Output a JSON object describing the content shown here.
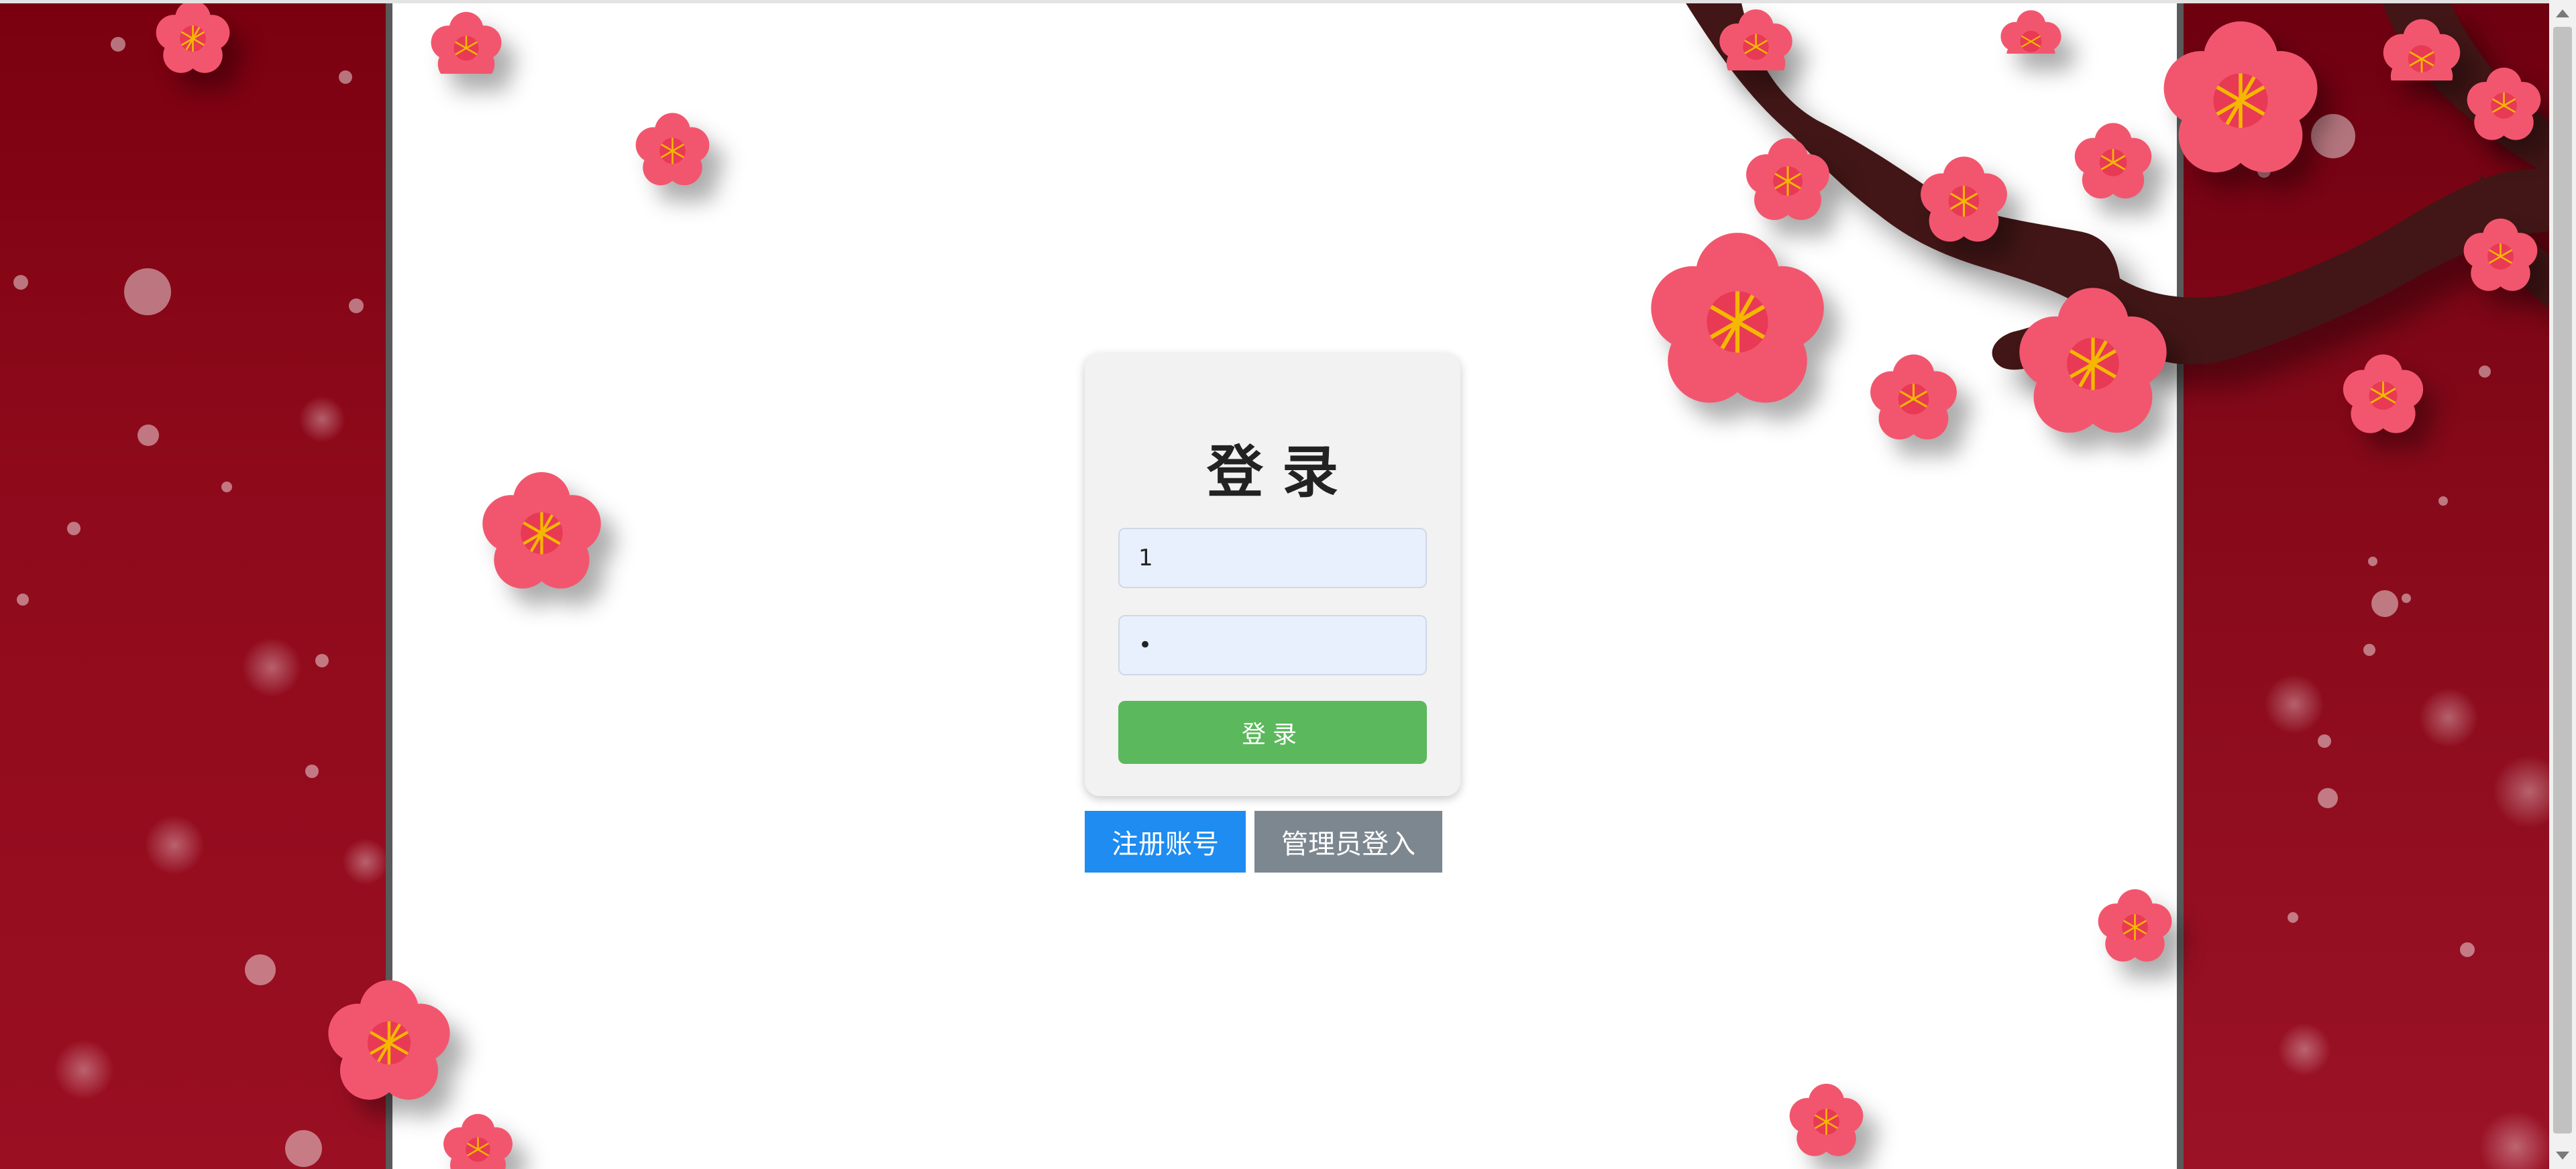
{
  "login": {
    "title": "登录",
    "username_value": "1",
    "password_value": "1",
    "submit_label": "登录"
  },
  "actions": {
    "register_label": "注册账号",
    "admin_login_label": "管理员登入"
  },
  "colors": {
    "panel_red": "#8e0a1b",
    "login_green": "#5cb85c",
    "register_blue": "#1e8cf0",
    "admin_gray": "#7d8790",
    "blossom_pink": "#f2566e",
    "branch_brown": "#421413"
  },
  "decor": {
    "background_icon": "plum-blossom-branch"
  }
}
